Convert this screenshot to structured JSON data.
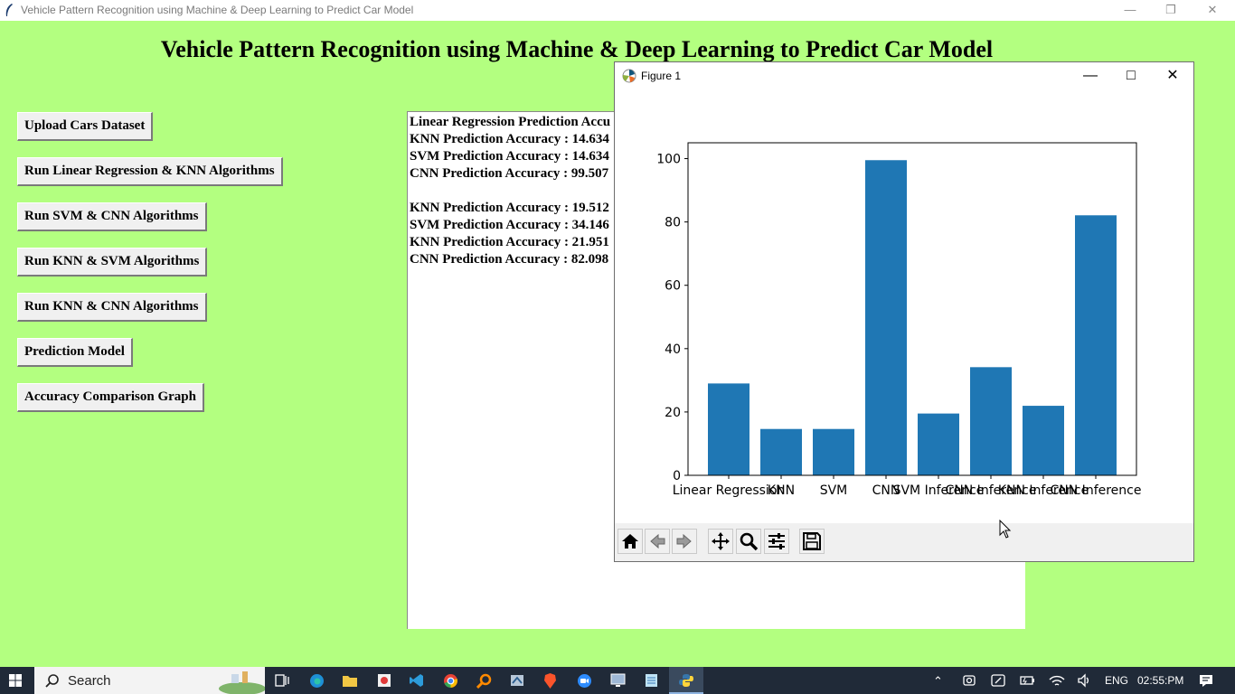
{
  "window": {
    "title": "Vehicle Pattern Recognition using Machine & Deep Learning to Predict Car Model"
  },
  "app": {
    "heading": "Vehicle Pattern Recognition using Machine & Deep Learning to Predict Car Model",
    "buttons": [
      {
        "label": "Upload Cars Dataset"
      },
      {
        "label": "Run Linear Regression & KNN Algorithms"
      },
      {
        "label": "Run SVM & CNN Algorithms"
      },
      {
        "label": "Run KNN & SVM Algorithms"
      },
      {
        "label": "Run KNN & CNN Algorithms"
      },
      {
        "label": "Prediction Model"
      },
      {
        "label": "Accuracy Comparison Graph"
      }
    ],
    "output_lines": [
      "Linear Regression Prediction Accu",
      "KNN Prediction Accuracy : 14.634",
      "SVM Prediction Accuracy : 14.634",
      "CNN Prediction Accuracy : 99.507",
      "",
      "KNN Prediction Accuracy : 19.512",
      "SVM Prediction Accuracy : 34.146",
      "KNN Prediction Accuracy : 21.951",
      "CNN Prediction Accuracy : 82.098"
    ]
  },
  "figure": {
    "title": "Figure 1",
    "toolbar": [
      "home-icon",
      "back-icon",
      "forward-icon",
      "pan-icon",
      "zoom-icon",
      "configure-icon",
      "save-icon"
    ]
  },
  "chart_data": {
    "type": "bar",
    "categories": [
      "Linear Regression",
      "KNN",
      "SVM",
      "CNN",
      "SVM Inference",
      "CNN Inference",
      "KNN Inference",
      "CNN Inference"
    ],
    "values": [
      29,
      14.634,
      14.634,
      99.507,
      19.512,
      34.146,
      21.951,
      82.098
    ],
    "ylim": [
      0,
      100
    ],
    "yticks": [
      "0",
      "20",
      "40",
      "60",
      "80",
      "100"
    ],
    "color": "#1f77b4",
    "title": "",
    "xlabel": "",
    "ylabel": ""
  },
  "taskbar": {
    "search_label": "Search",
    "language": "ENG",
    "time": "02:55:PM"
  }
}
